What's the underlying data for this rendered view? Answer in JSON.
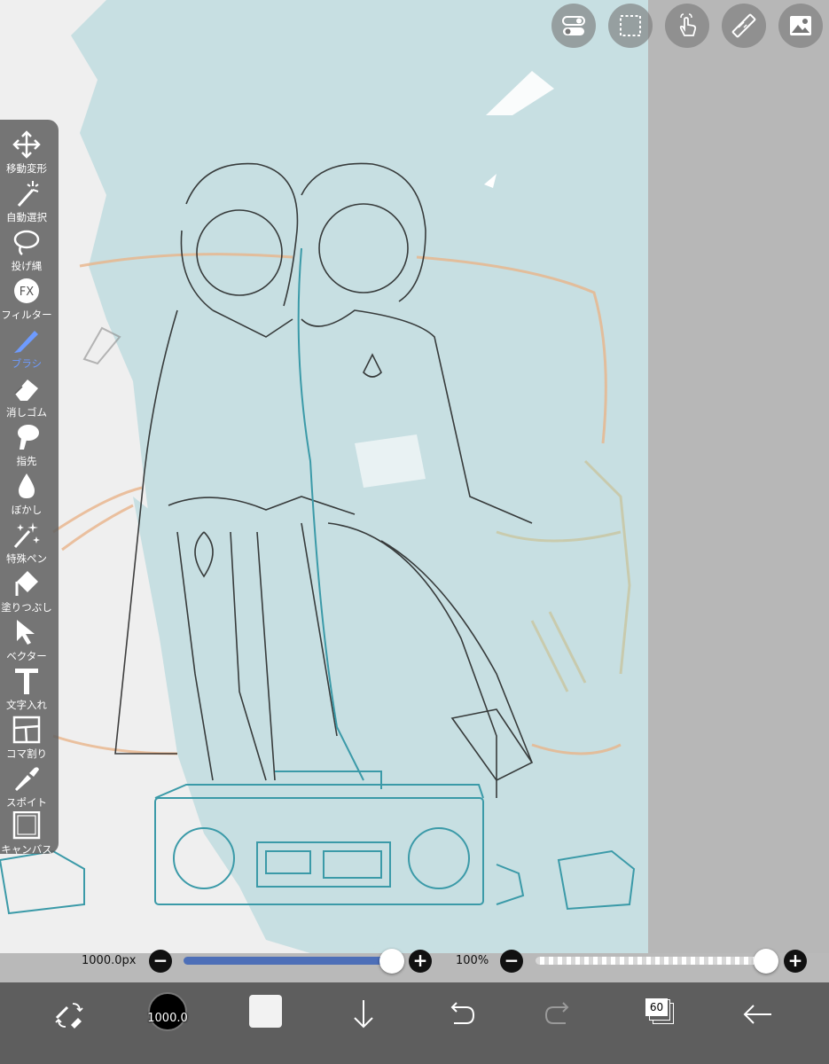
{
  "toolbar": {
    "tools": [
      {
        "label": "移動変形",
        "icon": "move-transform-icon"
      },
      {
        "label": "自動選択",
        "icon": "magic-wand-icon"
      },
      {
        "label": "投げ縄",
        "icon": "lasso-icon"
      },
      {
        "label": "フィルター",
        "icon": "fx-filter-icon"
      },
      {
        "label": "ブラシ",
        "icon": "brush-icon",
        "active": true
      },
      {
        "label": "消しゴム",
        "icon": "eraser-icon"
      },
      {
        "label": "指先",
        "icon": "finger-smudge-icon"
      },
      {
        "label": "ぼかし",
        "icon": "blur-drop-icon"
      },
      {
        "label": "特殊ペン",
        "icon": "special-pen-icon"
      },
      {
        "label": "塗りつぶし",
        "icon": "fill-bucket-icon"
      },
      {
        "label": "ベクター",
        "icon": "vector-cursor-icon"
      },
      {
        "label": "文字入れ",
        "icon": "text-icon"
      },
      {
        "label": "コマ割り",
        "icon": "frame-divide-icon"
      },
      {
        "label": "スポイト",
        "icon": "eyedropper-icon"
      },
      {
        "label": "キャンバス",
        "icon": "canvas-icon"
      }
    ]
  },
  "top_buttons": [
    "toggle-icon",
    "selection-icon",
    "touch-gesture-icon",
    "ruler-icon",
    "material-icon"
  ],
  "brush_size": {
    "label": "1000.0px",
    "value_fraction": 1.0
  },
  "opacity": {
    "label": "100%",
    "value_fraction": 1.0
  },
  "bottom_bar": {
    "brush_size_text": "1000.0",
    "layer_count": "60",
    "current_color": "#f2f2f2"
  },
  "colors": {
    "accent": "#6e9bff",
    "slider_fill": "#4d6fb8",
    "canvas_blue": "#c7dfe2",
    "sketch_teal": "#3b9aa8",
    "sketch_orange": "#e9b48a"
  }
}
